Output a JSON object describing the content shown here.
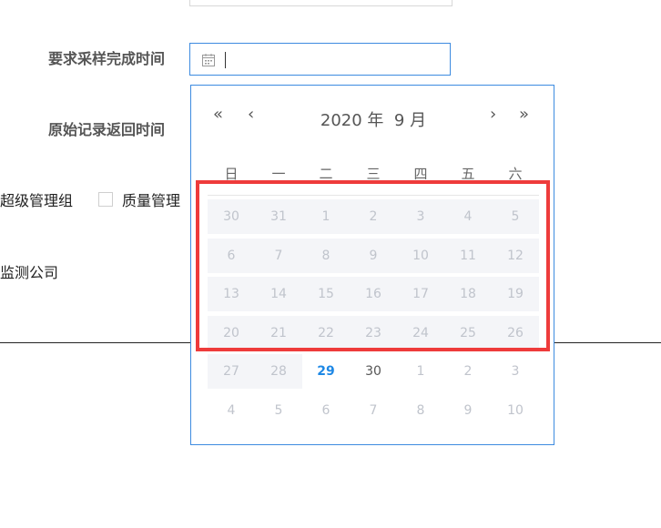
{
  "form": {
    "label_sampling_deadline": "要求采样完成时间",
    "label_record_return_time": "原始记录返回时间",
    "date_input_value": ""
  },
  "groups": {
    "super_admin": "超级管理组",
    "quality_admin": "质量管理",
    "company": "监测公司"
  },
  "datepicker": {
    "year_label": "2020 年",
    "month_label": "9 月",
    "nav_prev_year": "«",
    "nav_prev_month": "‹",
    "nav_next_month": "›",
    "nav_next_year": "»",
    "weekdays": [
      "日",
      "一",
      "二",
      "三",
      "四",
      "五",
      "六"
    ],
    "weeks": [
      [
        {
          "d": "30",
          "s": "past"
        },
        {
          "d": "31",
          "s": "past"
        },
        {
          "d": "1",
          "s": "past"
        },
        {
          "d": "2",
          "s": "past"
        },
        {
          "d": "3",
          "s": "past"
        },
        {
          "d": "4",
          "s": "past"
        },
        {
          "d": "5",
          "s": "past"
        }
      ],
      [
        {
          "d": "6",
          "s": "past"
        },
        {
          "d": "7",
          "s": "past"
        },
        {
          "d": "8",
          "s": "past"
        },
        {
          "d": "9",
          "s": "past"
        },
        {
          "d": "10",
          "s": "past"
        },
        {
          "d": "11",
          "s": "past"
        },
        {
          "d": "12",
          "s": "past"
        }
      ],
      [
        {
          "d": "13",
          "s": "past"
        },
        {
          "d": "14",
          "s": "past"
        },
        {
          "d": "15",
          "s": "past"
        },
        {
          "d": "16",
          "s": "past"
        },
        {
          "d": "17",
          "s": "past"
        },
        {
          "d": "18",
          "s": "past"
        },
        {
          "d": "19",
          "s": "past"
        }
      ],
      [
        {
          "d": "20",
          "s": "past"
        },
        {
          "d": "21",
          "s": "past"
        },
        {
          "d": "22",
          "s": "past"
        },
        {
          "d": "23",
          "s": "past"
        },
        {
          "d": "24",
          "s": "past"
        },
        {
          "d": "25",
          "s": "past"
        },
        {
          "d": "26",
          "s": "past"
        }
      ],
      [
        {
          "d": "27",
          "s": "past"
        },
        {
          "d": "28",
          "s": "past"
        },
        {
          "d": "29",
          "s": "today"
        },
        {
          "d": "30",
          "s": "current"
        },
        {
          "d": "1",
          "s": "muted"
        },
        {
          "d": "2",
          "s": "muted"
        },
        {
          "d": "3",
          "s": "muted"
        }
      ],
      [
        {
          "d": "4",
          "s": "muted"
        },
        {
          "d": "5",
          "s": "muted"
        },
        {
          "d": "6",
          "s": "muted"
        },
        {
          "d": "7",
          "s": "muted"
        },
        {
          "d": "8",
          "s": "muted"
        },
        {
          "d": "9",
          "s": "muted"
        },
        {
          "d": "10",
          "s": "muted"
        }
      ]
    ]
  },
  "colors": {
    "accent": "#3d8be0",
    "today": "#1e88e5",
    "highlight": "#ee3b3b"
  }
}
